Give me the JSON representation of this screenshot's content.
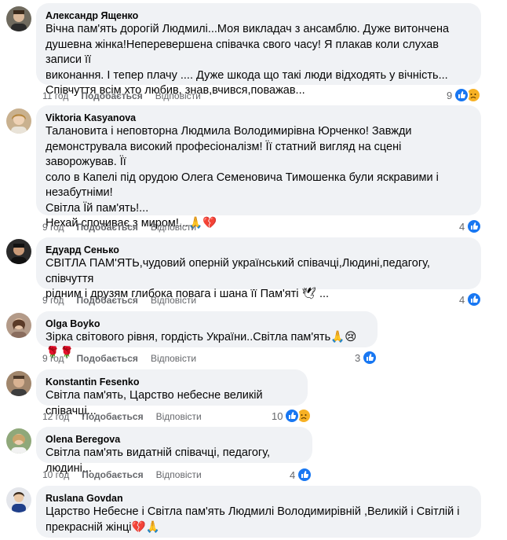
{
  "comments": [
    {
      "author": "Александр Ященко",
      "text": "Вічна пам'ять дорогій Людмилі...Моя викладач з ансамблю. Дуже витончена\nдушевна жінка!Неперевершена співачка свого часу! Я плакав коли слухав записи її\nвиконання. І тепер плачу .... Дуже шкода що такі люди відходять у вічність...\nСпівчуття всім хто любив, знав,вчився,поважав...",
      "time": "11 год",
      "like": "Подобається",
      "reply": "Відповісти",
      "reactions": "9",
      "reaction_icons": [
        "like-icon",
        "sad-icon"
      ]
    },
    {
      "author": "Viktoria Kasyanova",
      "text": "Талановита і неповторна Людмила Володимирівна Юрченко! Завжди\nдемонструвала високий професіоналізм! Її статний вигляд на сцені заворожував. Її\nсоло в Капелі під орудою Олега Семеновича Тимошенка були яскравими і\nнезабутніми!\nСвітла Їй пам'ять!...\nНехай спочиває з миром!...🙏💔",
      "time": "9 год",
      "like": "Подобається",
      "reply": "Відповісти",
      "reactions": "4",
      "reaction_icons": [
        "like-icon"
      ]
    },
    {
      "author": "Едуард Сенько",
      "text": "СВІТЛА ПАМ'ЯТЬ,чудовий оперній український співачці,Людині,педагогу, співчуття\nрідним і друзям глибока повага і шана її Пам'яті 🕊 ...",
      "time": "9 год",
      "like": "Подобається",
      "reply": "Відповісти",
      "reactions": "4",
      "reaction_icons": [
        "like-icon"
      ]
    },
    {
      "author": "Olga Boyko",
      "text": "Зірка світового рівня, гордість України..Світла пам'ять🙏😢🌹🌹",
      "time": "9 год",
      "like": "Подобається",
      "reply": "Відповісти",
      "reactions": "3",
      "reaction_icons": [
        "like-icon"
      ]
    },
    {
      "author": "Konstantin Fesenko",
      "text": "Світла пам'ять, Царство небесне великій співачці...",
      "time": "12 год",
      "like": "Подобається",
      "reply": "Відповісти",
      "reactions": "10",
      "reaction_icons": [
        "like-icon",
        "sad-icon"
      ]
    },
    {
      "author": "Olena Beregova",
      "text": "Світла пам'ять видатній співачці, педагогу, людині...",
      "time": "10 год",
      "like": "Подобається",
      "reply": "Відповісти",
      "reactions": "4",
      "reaction_icons": [
        "like-icon"
      ]
    },
    {
      "author": "Ruslana Govdan",
      "text": "Царство Небесне і Світла пам'ять Людмилі Володимирівній ,Великій і Світлій і\nпрекрасній жінці💔🙏",
      "time": "",
      "like": "",
      "reply": "",
      "reactions": "",
      "reaction_icons": []
    }
  ],
  "colors": {
    "bubble": "#f0f2f5",
    "like": "#1877f2",
    "sad": "#f7b125",
    "meta": "#65676b"
  }
}
